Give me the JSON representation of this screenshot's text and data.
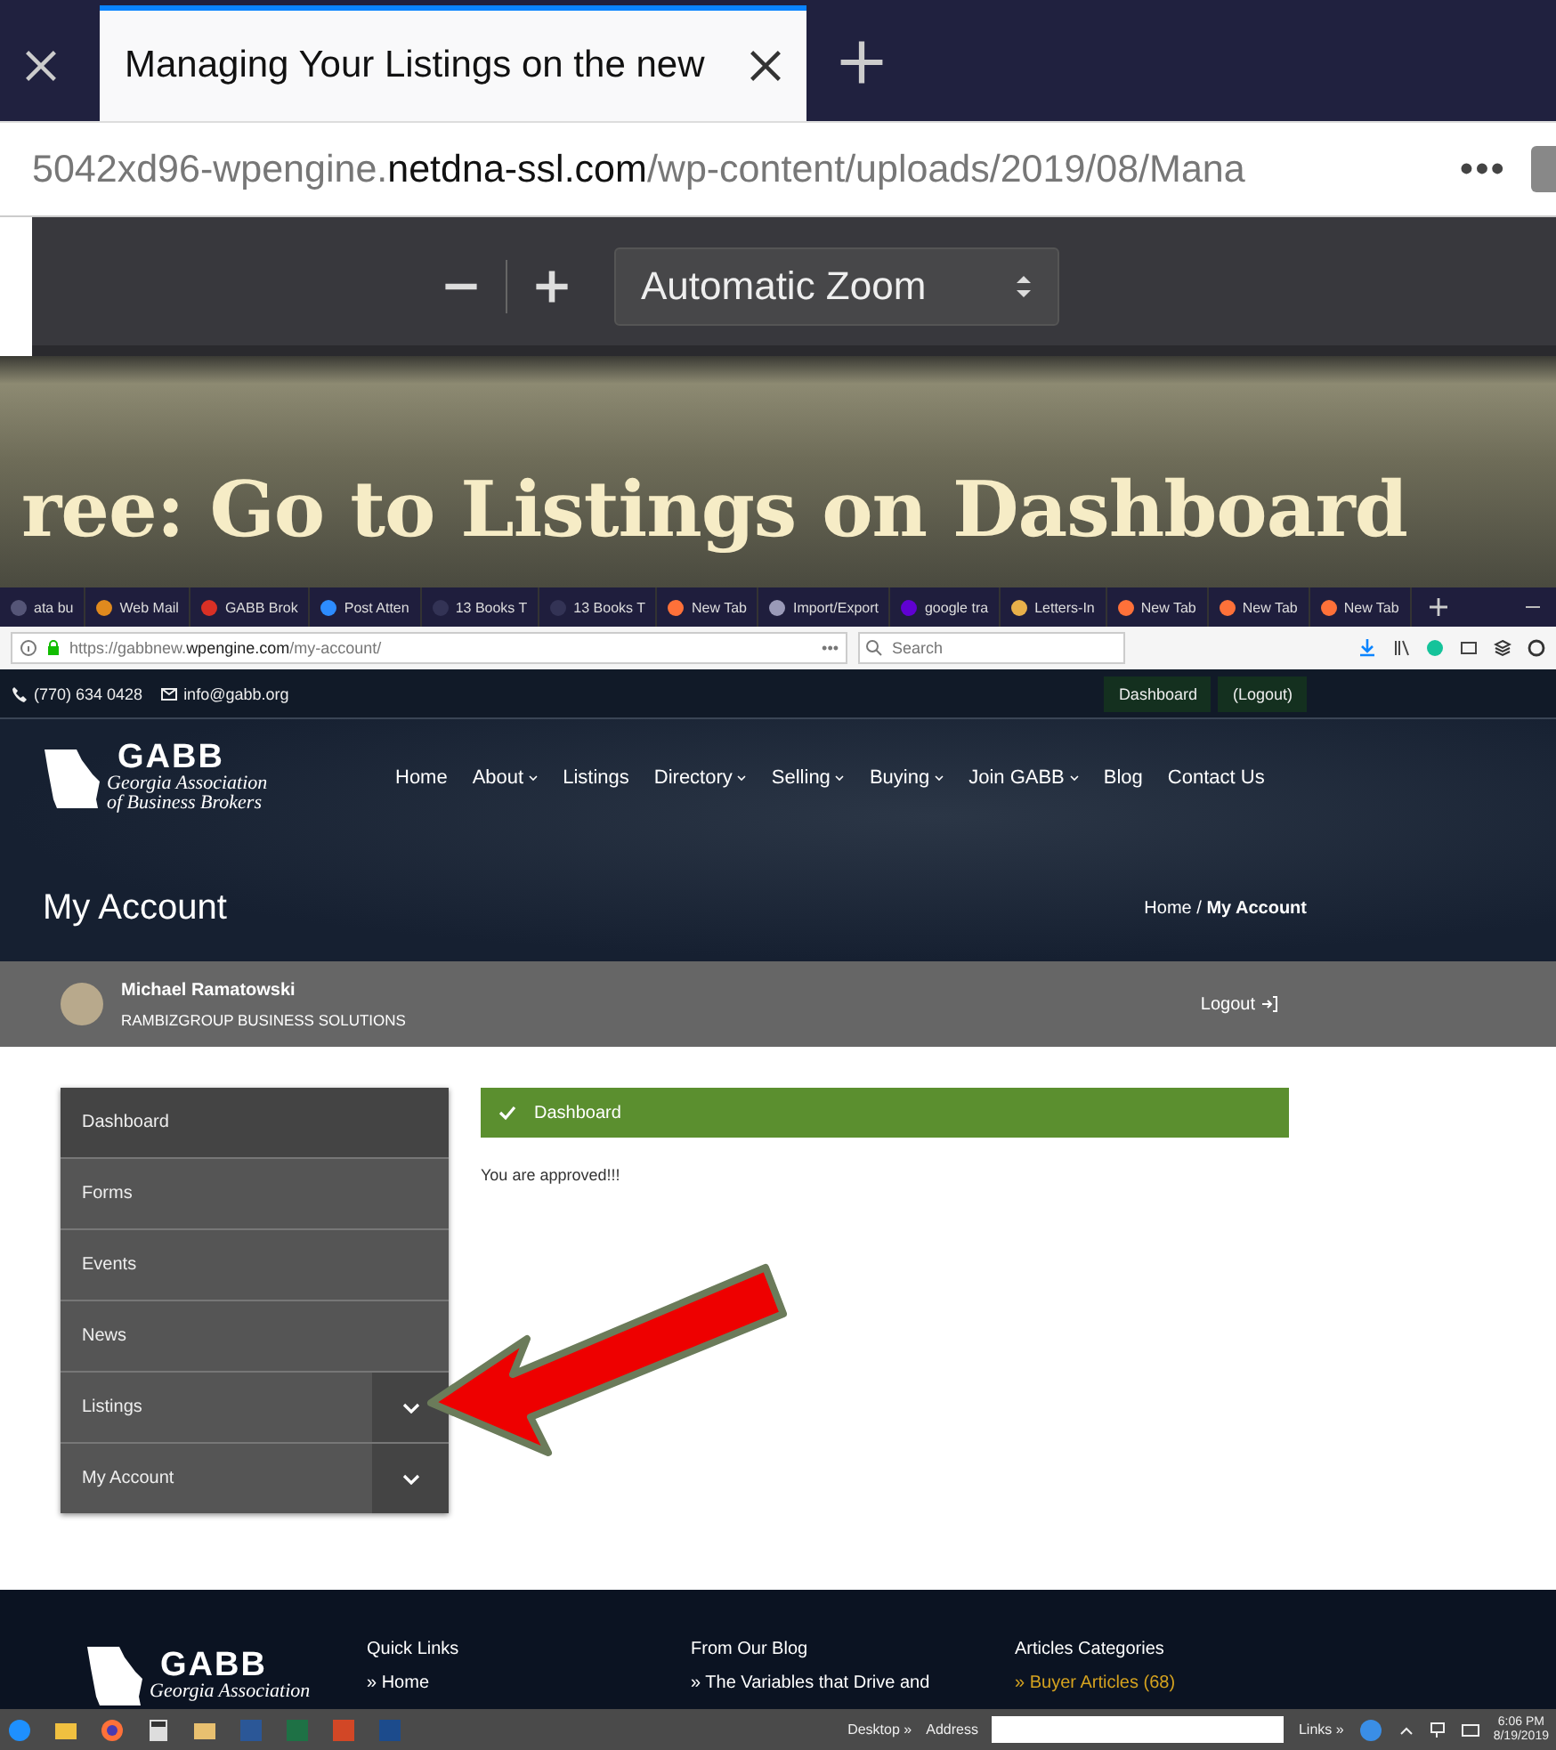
{
  "browser": {
    "tabs": [
      {
        "title": "Managing Your Listings on the new",
        "selected": true
      }
    ],
    "url": "5042xd96-wpengine.**netdna-ssl.com**/wp-content/uploads/2019/08/Mana",
    "page_actions": "•••"
  },
  "pdf_toolbar": {
    "zoom": "Automatic Zoom"
  },
  "banner": {
    "heading": "ree: Go to Listings on Dashboard"
  },
  "screenshot": {
    "tabs": [
      {
        "title": "ata bu",
        "color": "#555577"
      },
      {
        "title": "Web Mail",
        "color": "#e08a1e"
      },
      {
        "title": "GABB Brok",
        "color": "#d93025"
      },
      {
        "title": "Post Atten",
        "color": "#2d8cff"
      },
      {
        "title": "13 Books T",
        "color": "#333355"
      },
      {
        "title": "13 Books T",
        "color": "#333355"
      },
      {
        "title": "New Tab",
        "color": "#ff7139"
      },
      {
        "title": "Import/Export",
        "color": "#9a9ab8"
      },
      {
        "title": "google tra",
        "color": "#6001d2"
      },
      {
        "title": "Letters-In",
        "color": "#e8b04a"
      },
      {
        "title": "New Tab",
        "color": "#ff7139"
      },
      {
        "title": "New Tab",
        "color": "#ff7139"
      },
      {
        "title": "New Tab",
        "color": "#ff7139"
      }
    ],
    "url": "https://gabbnew.**wpengine.com**/my-account/",
    "page_actions": "•••",
    "search": {
      "placeholder": "Search"
    },
    "topbar": {
      "phone": "(770) 634 0428",
      "email": "info@gabb.org",
      "links": [
        "Dashboard",
        "(Logout)"
      ]
    },
    "site": {
      "logo": {
        "title": "GABB",
        "line1": "Georgia Association",
        "line2": "of Business Brokers"
      },
      "nav": [
        {
          "label": "Home",
          "dropdown": false
        },
        {
          "label": "About",
          "dropdown": true
        },
        {
          "label": "Listings",
          "dropdown": false
        },
        {
          "label": "Directory",
          "dropdown": true
        },
        {
          "label": "Selling",
          "dropdown": true
        },
        {
          "label": "Buying",
          "dropdown": true
        },
        {
          "label": "Join GABB",
          "dropdown": true
        },
        {
          "label": "Blog",
          "dropdown": false
        },
        {
          "label": "Contact Us",
          "dropdown": false
        }
      ],
      "page_title": "My Account",
      "breadcrumb": "Home / **My Account**"
    },
    "user": {
      "name": "Michael Ramatowski",
      "company": "RAMBIZGROUP BUSINESS SOLUTIONS",
      "logout": "Logout"
    },
    "menu": [
      {
        "label": "Dashboard",
        "selected": true,
        "expandable": false
      },
      {
        "label": "Forms",
        "selected": false,
        "expandable": false
      },
      {
        "label": "Events",
        "selected": false,
        "expandable": false
      },
      {
        "label": "News",
        "selected": false,
        "expandable": false
      },
      {
        "label": "Listings",
        "selected": false,
        "expandable": true
      },
      {
        "label": "My Account",
        "selected": false,
        "expandable": true
      }
    ],
    "notice": "Dashboard",
    "message": "You are approved!!!",
    "footer": {
      "logo": {
        "title": "GABB",
        "line1": "Georgia Association"
      },
      "columns": [
        {
          "heading": "Quick Links",
          "link": "» Home"
        },
        {
          "heading": "From Our Blog",
          "link": "» The Variables that Drive and"
        },
        {
          "heading": "Articles Categories",
          "link": "» Buyer Articles (68)"
        }
      ]
    }
  },
  "taskbar": {
    "desktop": "Desktop",
    "address_label": "Address",
    "links": "Links",
    "chevron": "»",
    "time": "6:06 PM",
    "date": "8/19/2019"
  }
}
